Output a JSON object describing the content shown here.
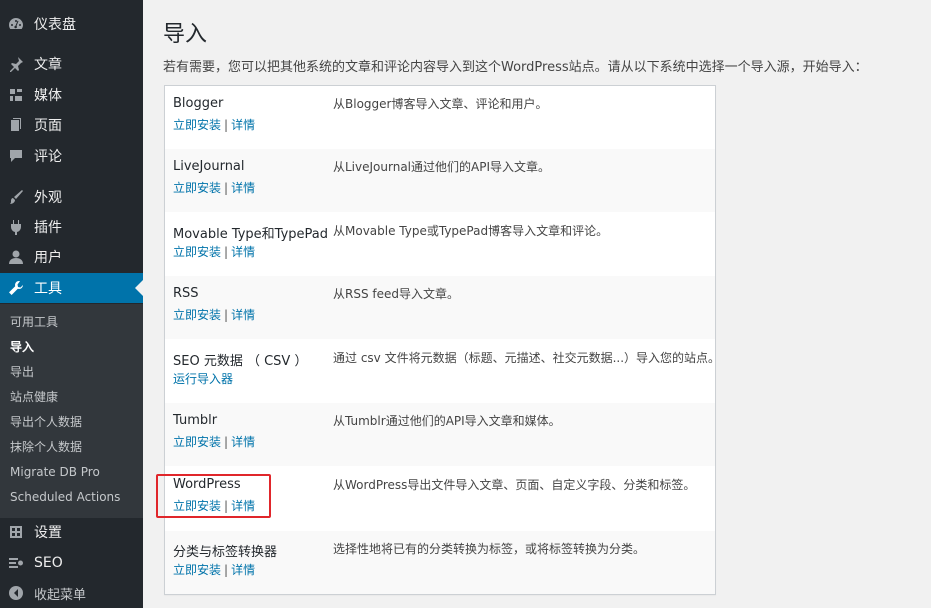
{
  "sidebar": {
    "items": [
      {
        "label": "仪表盘",
        "icon": "dashboard-icon"
      },
      {
        "label": "文章",
        "icon": "pin-icon"
      },
      {
        "label": "媒体",
        "icon": "media-icon"
      },
      {
        "label": "页面",
        "icon": "page-icon"
      },
      {
        "label": "评论",
        "icon": "comment-icon"
      },
      {
        "label": "外观",
        "icon": "brush-icon"
      },
      {
        "label": "插件",
        "icon": "plugin-icon"
      },
      {
        "label": "用户",
        "icon": "user-icon"
      },
      {
        "label": "工具",
        "icon": "wrench-icon"
      },
      {
        "label": "设置",
        "icon": "settings-icon"
      },
      {
        "label": "SEO",
        "icon": "seo-icon"
      },
      {
        "label": "收起菜单",
        "icon": "collapse-icon"
      }
    ],
    "submenu": [
      "可用工具",
      "导入",
      "导出",
      "站点健康",
      "导出个人数据",
      "抹除个人数据",
      "Migrate DB Pro",
      "Scheduled Actions"
    ]
  },
  "main": {
    "title": "导入",
    "intro": "若有需要，您可以把其他系统的文章和评论内容导入到这个WordPress站点。请从以下系统中选择一个导入源，开始导入：",
    "importers": [
      {
        "name": "Blogger",
        "install": "立即安装",
        "sep": "|",
        "details": "详情",
        "desc": "从Blogger博客导入文章、评论和用户。"
      },
      {
        "name": "LiveJournal",
        "install": "立即安装",
        "sep": "|",
        "details": "详情",
        "desc": "从LiveJournal通过他们的API导入文章。"
      },
      {
        "name": "Movable Type和TypePad",
        "install": "立即安装",
        "sep": "|",
        "details": "详情",
        "desc": "从Movable Type或TypePad博客导入文章和评论。"
      },
      {
        "name": "RSS",
        "install": "立即安装",
        "sep": "|",
        "details": "详情",
        "desc": "从RSS feed导入文章。"
      },
      {
        "name": "SEO 元数据 （ CSV ）",
        "install": "运行导入器",
        "desc": "通过 csv 文件将元数据（标题、元描述、社交元数据...）导入您的站点。"
      },
      {
        "name": "Tumblr",
        "install": "立即安装",
        "sep": "|",
        "details": "详情",
        "desc": "从Tumblr通过他们的API导入文章和媒体。"
      },
      {
        "name": "WordPress",
        "install": "立即安装",
        "sep": "|",
        "details": "详情",
        "desc": "从WordPress导出文件导入文章、页面、自定义字段、分类和标签。"
      },
      {
        "name": "分类与标签转换器",
        "install": "立即安装",
        "sep": "|",
        "details": "详情",
        "desc": "选择性地将已有的分类转换为标签，或将标签转换为分类。"
      }
    ]
  },
  "colors": {
    "accent": "#0073aa",
    "sidebar_bg": "#23282d",
    "highlight": "#e0262b"
  }
}
